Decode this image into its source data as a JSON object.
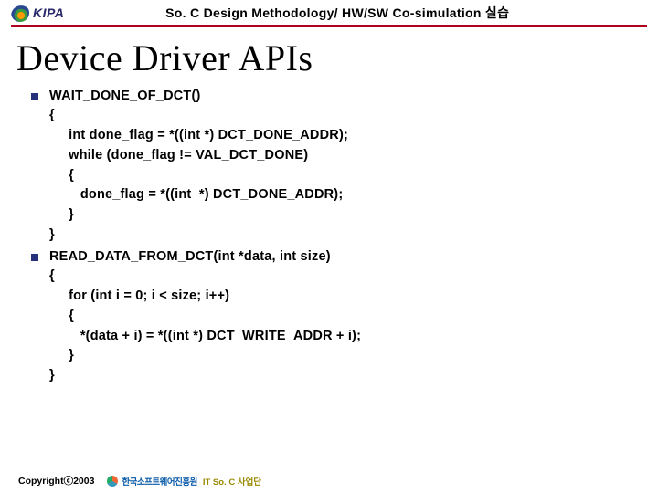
{
  "header": {
    "logo_text": "KIPA",
    "title": "So. C Design Methodology/ HW/SW Co-simulation 실습"
  },
  "slide": {
    "title": "Device Driver APIs"
  },
  "items": [
    {
      "code": "WAIT_DONE_OF_DCT()\n{\n     int done_flag = *((int *) DCT_DONE_ADDR);\n     while (done_flag != VAL_DCT_DONE)\n     {\n        done_flag = *((int  *) DCT_DONE_ADDR);\n     }\n}"
    },
    {
      "code": "READ_DATA_FROM_DCT(int *data, int size)\n{\n     for (int i = 0; i < size; i++)\n     {\n        *(data + i) = *((int *) DCT_WRITE_ADDR + i);\n     }\n}"
    }
  ],
  "footer": {
    "copyright": "Copyrightⓒ2003",
    "branding_kor": "한국소프트웨어진흥원",
    "branding_lat": "IT So. C 사업단"
  }
}
